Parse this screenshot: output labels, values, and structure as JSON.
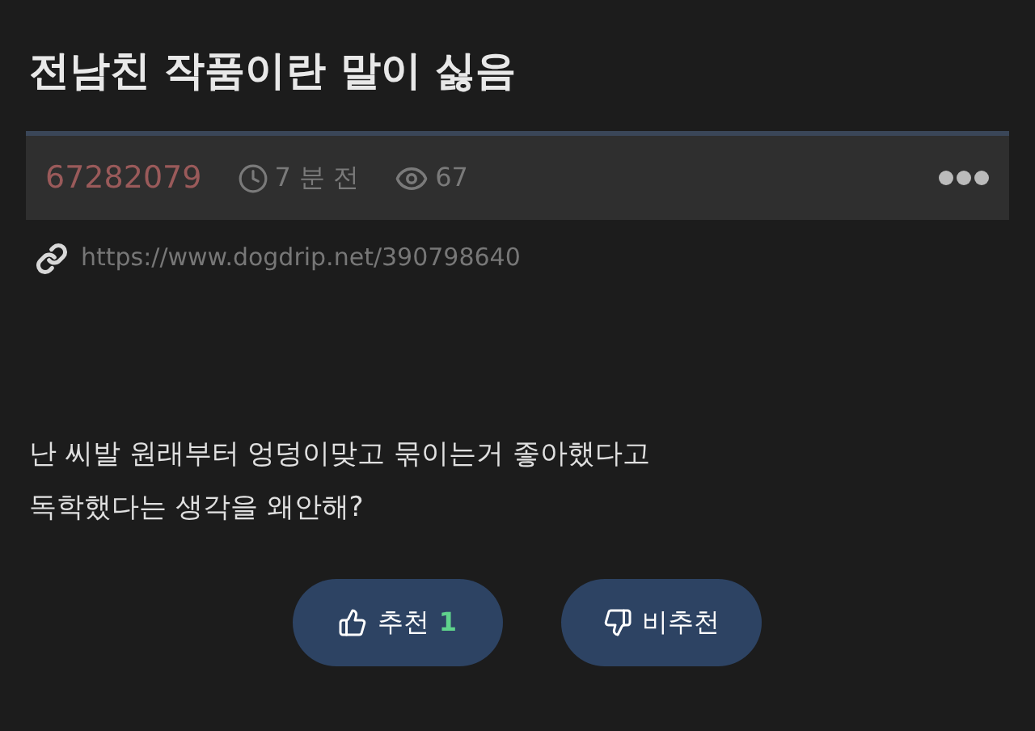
{
  "title": "전남친 작품이란 말이 싫음",
  "meta": {
    "author": "67282079",
    "time": "7 분 전",
    "views": "67"
  },
  "link": "https://www.dogdrip.net/390798640",
  "body": [
    "난 씨발 원래부터 엉덩이맞고 묶이는거 좋아했다고",
    "독학했다는 생각을 왜안해?"
  ],
  "votes": {
    "up_label": "추천",
    "up_count": "1",
    "down_label": "비추천"
  }
}
